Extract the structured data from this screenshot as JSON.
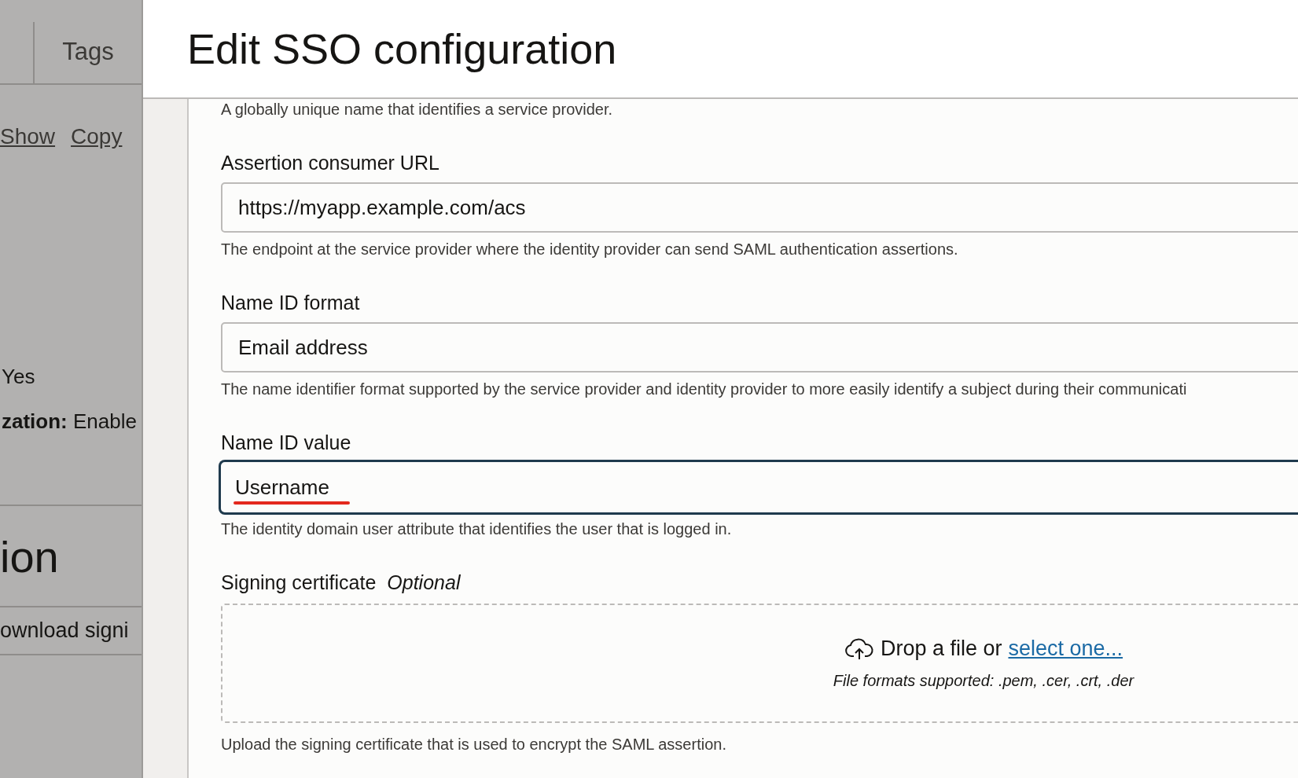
{
  "side_panel": {
    "tabs": [
      {
        "label": "Tags",
        "selected": false
      }
    ],
    "links": [
      "Show",
      "Copy"
    ],
    "details": [
      {
        "value": "Yes"
      },
      {
        "label": "zation:",
        "value": "Enable"
      }
    ],
    "section_title": "ion",
    "action": "ownload signi"
  },
  "dialog": {
    "title": "Edit SSO configuration",
    "intro_help": "A globally unique name that identifies a service provider.",
    "fields": [
      {
        "kind": "text",
        "label": "Assertion consumer URL",
        "value": "https://myapp.example.com/acs",
        "help": "The endpoint at the service provider where the identity provider can send SAML authentication assertions.",
        "focused": false
      },
      {
        "kind": "text",
        "label": "Name ID format",
        "value": "Email address",
        "help": "The name identifier format supported by the service provider and identity provider to more easily identify a subject during their communicati",
        "focused": false
      },
      {
        "kind": "text",
        "label": "Name ID value",
        "value": "Username",
        "help": "The identity domain user attribute that identifies the user that is logged in.",
        "focused": true,
        "annotated": true
      },
      {
        "kind": "file",
        "label": "Signing certificate",
        "optional": "Optional",
        "drop_text": "Drop a file or",
        "link": "select one...",
        "formats": "File formats supported: .pem, .cer, .crt, .der",
        "help": "Upload the signing certificate that is used to encrypt the SAML assertion."
      }
    ]
  }
}
